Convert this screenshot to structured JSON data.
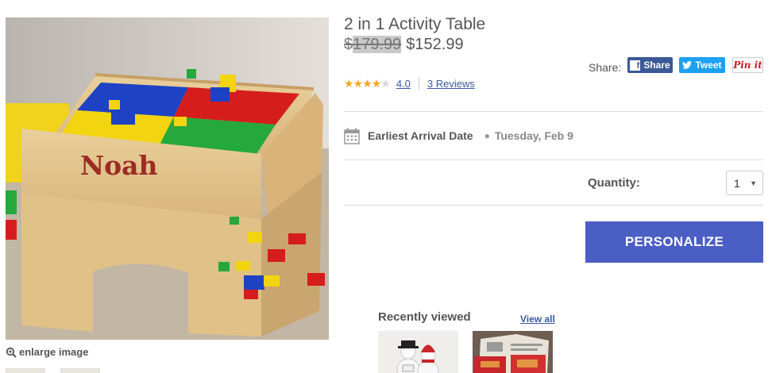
{
  "product": {
    "title": "2 in 1 Activity Table",
    "old_price_prefix": "$",
    "old_price_rest": "179.99",
    "new_price": "$152.99",
    "image_text": "Noah",
    "enlarge_label": "enlarge image"
  },
  "share": {
    "label": "Share:",
    "facebook_label": "Share",
    "twitter_label": "Tweet",
    "pinterest_label": "Pin it"
  },
  "rating": {
    "value": "4.0",
    "stars_filled": 4,
    "stars_total": 5,
    "reviews_label": "3 Reviews",
    "star_color": "#f5a623"
  },
  "arrival": {
    "label": "Earliest Arrival Date",
    "date": "Tuesday, Feb 9",
    "icon": "calendar-icon"
  },
  "quantity": {
    "label": "Quantity:",
    "selected": "1"
  },
  "cta": {
    "personalize_label": "PERSONALIZE",
    "color": "#4a5ec4"
  },
  "recently_viewed": {
    "title": "Recently viewed",
    "view_all_label": "View all"
  }
}
